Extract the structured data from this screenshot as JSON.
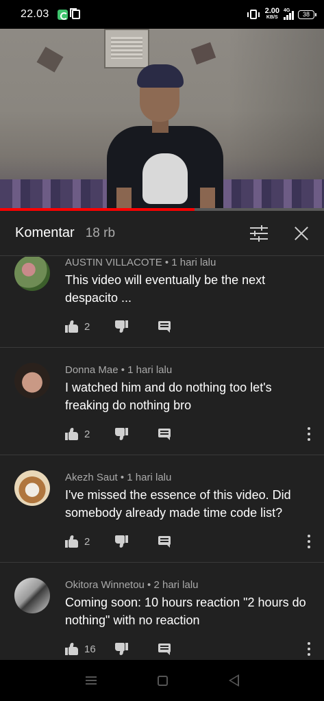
{
  "status_bar": {
    "time": "22.03",
    "speed_value": "2.00",
    "speed_unit": "KB/S",
    "network": "4G",
    "battery": "38"
  },
  "video": {
    "progress_percent": 60
  },
  "comments_panel": {
    "title": "Komentar",
    "count": "18 rb",
    "sort_icon": "tune-icon",
    "close_icon": "close-icon",
    "comments": [
      {
        "author": "AUSTIN VILLACOTE",
        "time": "1 hari lalu",
        "meta": "AUSTIN VILLACOTE • 1 hari lalu",
        "text": "This video will eventually be the next despacito ...",
        "likes": "2"
      },
      {
        "author": "Donna Mae",
        "time": "1 hari lalu",
        "meta": "Donna Mae • 1 hari lalu",
        "text": "I watched  him and do nothing too let's freaking do nothing bro",
        "likes": "2"
      },
      {
        "author": "Akezh Saut",
        "time": "1 hari lalu",
        "meta": "Akezh Saut • 1 hari lalu",
        "text": "I've missed the essence of this video. Did somebody already made time code list?",
        "likes": "2"
      },
      {
        "author": "Okitora Winnetou",
        "time": "2 hari lalu",
        "meta": "Okitora Winnetou • 2 hari lalu",
        "text": "Coming soon: 10 hours reaction \"2 hours do nothing\" with no reaction",
        "likes": "16"
      }
    ]
  },
  "colors": {
    "panel_bg": "#212121",
    "progress": "#ff0000",
    "secondary_text": "#aaaaaa"
  }
}
